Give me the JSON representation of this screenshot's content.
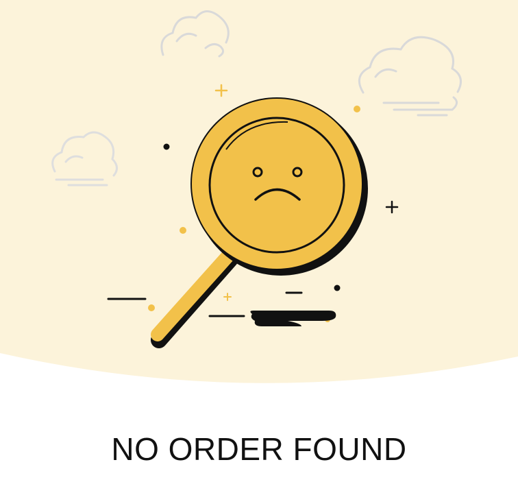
{
  "empty_state": {
    "message": "NO ORDER FOUND",
    "illustration_icon": "sad-magnifier-icon"
  },
  "colors": {
    "background_wave": "#fcf3da",
    "accent_yellow": "#f2c14a",
    "outline": "#111111",
    "cloud": "#d6d6d6",
    "text": "#111111"
  }
}
